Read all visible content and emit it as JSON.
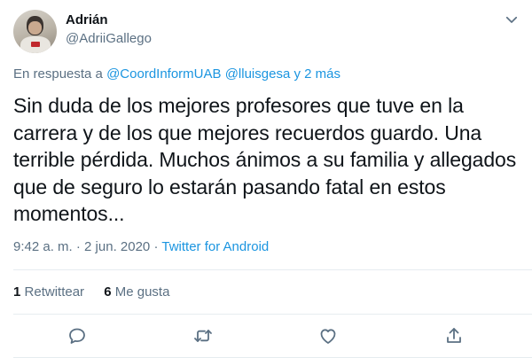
{
  "author": {
    "name": "Adrián",
    "handle": "@AdriiGallego"
  },
  "reply": {
    "prefix": "En respuesta a",
    "mentions": [
      "@CoordInformUAB",
      "@lluisgesa"
    ],
    "more": "y 2 más"
  },
  "tweet": {
    "text": "Sin duda de los mejores profesores que tuve en la carrera y de los que mejores recuerdos guardo. Una terrible pérdida. Muchos ánimos a su familia y allegados que de seguro lo estarán pasando fatal en estos momentos..."
  },
  "meta": {
    "time": "9:42 a. m.",
    "sep": "·",
    "date": "2 jun. 2020",
    "source": "Twitter for Android"
  },
  "stats": {
    "retweets_count": "1",
    "retweets_label": "Retwittear",
    "likes_count": "6",
    "likes_label": "Me gusta"
  },
  "icons": {
    "caret": "chevron-down-icon",
    "reply": "reply-icon",
    "retweet": "retweet-icon",
    "like": "heart-icon",
    "share": "share-icon"
  },
  "colors": {
    "link": "#1b95e0",
    "secondary": "#5b7083",
    "divider": "#e6ecf0",
    "text": "#0f1419"
  }
}
